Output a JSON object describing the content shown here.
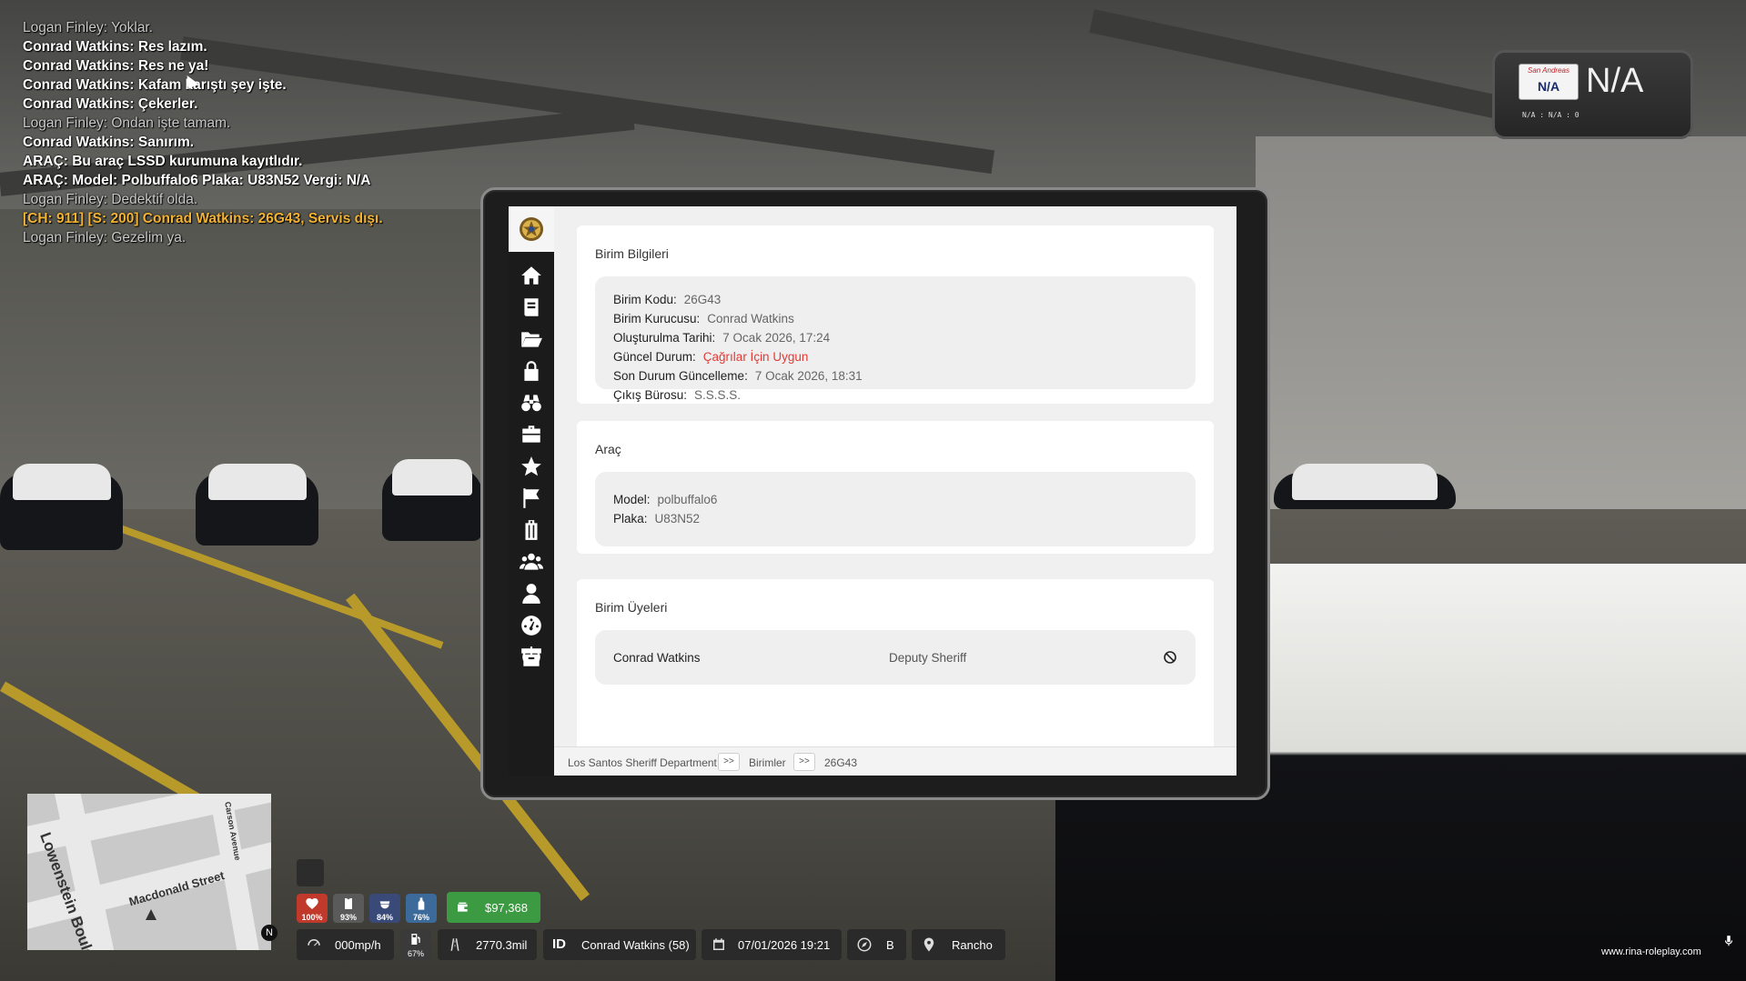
{
  "chat": [
    {
      "text": "Logan Finley: Yoklar.",
      "style": "gray"
    },
    {
      "text": "Conrad Watkins: Res lazım.",
      "style": "white"
    },
    {
      "text": "Conrad Watkins: Res ne ya!",
      "style": "white"
    },
    {
      "text": "Conrad Watkins: Kafam karıştı şey işte.",
      "style": "white"
    },
    {
      "text": "Conrad Watkins: Çekerler.",
      "style": "white"
    },
    {
      "text": "Logan Finley: Ondan işte tamam.",
      "style": "gray"
    },
    {
      "text": "Conrad Watkins: Sanırım.",
      "style": "white"
    },
    {
      "text": "ARAÇ: Bu araç LSSD kurumuna kayıtlıdır.",
      "style": "white"
    },
    {
      "text": "ARAÇ: Model: Polbuffalo6 Plaka: U83N52 Vergi: N/A",
      "style": "white"
    },
    {
      "text": "Logan Finley: Dedektif olda.",
      "style": "gray"
    },
    {
      "text": "[CH: 911] [S: 200] Conrad Watkins: 26G43, Servis dışı.",
      "style": "orange"
    },
    {
      "text": "Logan Finley: Gezelim ya.",
      "style": "gray"
    }
  ],
  "plate_reader": {
    "plate_state": "San Andreas",
    "plate_number": "N/A",
    "big_text": "N/A",
    "sub_text": "N/A : N/A : 0"
  },
  "tablet": {
    "nav_icons": [
      "home-icon",
      "book-icon",
      "folder-open-icon",
      "lock-icon",
      "binoculars-icon",
      "briefcase-icon",
      "star-icon",
      "flag-icon",
      "luggage-icon",
      "users-icon",
      "user-icon",
      "dashboard-icon",
      "archive-icon"
    ],
    "unit_info": {
      "title": "Birim Bilgileri",
      "rows": [
        {
          "label": "Birim Kodu:",
          "value": "26G43"
        },
        {
          "label": "Birim Kurucusu:",
          "value": "Conrad Watkins"
        },
        {
          "label": "Oluşturulma Tarihi:",
          "value": "7 Ocak 2026, 17:24"
        },
        {
          "label": "Güncel Durum:",
          "value": "Çağrılar İçin Uygun"
        },
        {
          "label": "Son Durum Güncelleme:",
          "value": "7 Ocak 2026, 18:31"
        },
        {
          "label": "Çıkış Bürosu:",
          "value": "S.S.S.S."
        }
      ],
      "status_color": "#e53935"
    },
    "vehicle": {
      "title": "Araç",
      "rows": [
        {
          "label": "Model:",
          "value": "polbuffalo6"
        },
        {
          "label": "Plaka:",
          "value": "U83N52"
        }
      ]
    },
    "members": {
      "title": "Birim Üyeleri",
      "list": [
        {
          "name": "Conrad Watkins",
          "rank": "Deputy Sheriff"
        }
      ]
    },
    "breadcrumb": {
      "items": [
        "Los Santos Sheriff Department",
        "Birimler",
        "26G43"
      ],
      "separator": ">>"
    }
  },
  "minimap": {
    "streets": [
      "Lowenstein Boulevard",
      "Macdonald Street",
      "Carson Avenue"
    ],
    "compass": "N"
  },
  "hud": {
    "health": "100%",
    "armor": "93%",
    "hunger": "84%",
    "thirst": "76%",
    "money": "$97,368",
    "speed": "000mp/h",
    "fuel": "67%",
    "mileage": "2770.3mil",
    "id_label": "ID",
    "player": "Conrad Watkins (58)",
    "datetime": "07/01/2026 19:21",
    "direction": "B",
    "location": "Rancho",
    "website": "www.rina-roleplay.com"
  }
}
